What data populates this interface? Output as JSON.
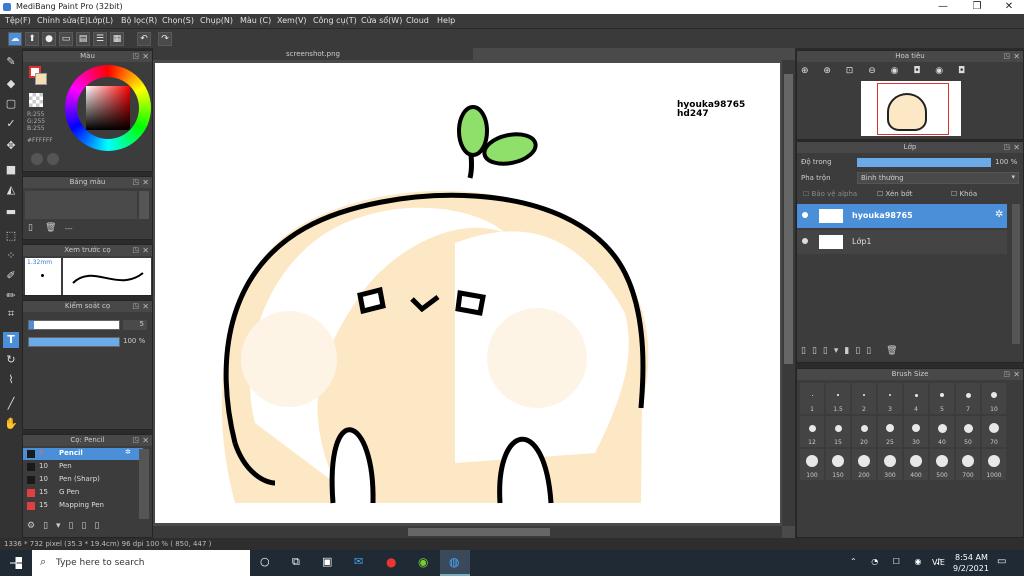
{
  "window": {
    "title": "MediBang Paint Pro (32bit)",
    "minimize": "—",
    "maximize": "❐",
    "close": "✕"
  },
  "menu": [
    "Tệp(F)",
    "Chỉnh sửa(E)",
    "Lớp(L)",
    "Bộ lọc(R)",
    "Chọn(S)",
    "Chụp(N)",
    "Màu (C)",
    "Xem(V)",
    "Công cụ(T)",
    "Cửa sổ(W)",
    "Cloud",
    "Help"
  ],
  "panels": {
    "color": {
      "title": "Màu",
      "rgb_r": "R:255",
      "rgb_g": "G:255",
      "rgb_b": "B:255",
      "hex": "#FFFFFF"
    },
    "palette": {
      "title": "Bảng màu",
      "value": "---"
    },
    "brush_preview": {
      "title": "Xem trước cọ",
      "size": "1.32mm"
    },
    "brush_control": {
      "title": "Kiểm soát cọ",
      "size_value": "5",
      "opacity_value": "100 %"
    },
    "brush_list": {
      "title": "Cọ: Pencil",
      "items": [
        {
          "size": "5",
          "name": "Pencil",
          "color": "#1a1a1a"
        },
        {
          "size": "10",
          "name": "Pen",
          "color": "#1a1a1a"
        },
        {
          "size": "10",
          "name": "Pen (Sharp)",
          "color": "#1a1a1a"
        },
        {
          "size": "15",
          "name": "G Pen",
          "color": "#e04040"
        },
        {
          "size": "15",
          "name": "Mapping Pen",
          "color": "#e04040"
        }
      ]
    },
    "navigator": {
      "title": "Hoa tiêu"
    },
    "layers": {
      "title": "Lớp",
      "opacity_label": "Độ trong",
      "opacity_value": "100 %",
      "blend_label": "Pha trộn",
      "blend_value": "Bình thường",
      "protect_alpha": "Bảo vệ alpha",
      "clipping": "Xén bớt",
      "lock": "Khóa",
      "items": [
        {
          "name": "hyouka98765",
          "selected": true
        },
        {
          "name": "Lớp1",
          "selected": false
        }
      ]
    },
    "brush_size": {
      "title": "Brush Size",
      "sizes": [
        "1",
        "1.5",
        "2",
        "3",
        "4",
        "5",
        "7",
        "10",
        "12",
        "15",
        "20",
        "25",
        "30",
        "40",
        "50",
        "70",
        "100",
        "150",
        "200",
        "300",
        "400",
        "500",
        "700",
        "1000"
      ]
    }
  },
  "document": {
    "tab": "screenshot.png",
    "watermark_line1": "hyouka98765",
    "watermark_line2": "hd247"
  },
  "status": {
    "info": "1336 * 732 pixel   (35.3 * 19.4cm)   96 dpi   100 %   ( 850, 447 )"
  },
  "taskbar": {
    "search_placeholder": "Type here to search",
    "time": "8:54 AM",
    "date": "9/2/2021",
    "lang": "VIE"
  },
  "colors": {
    "accent": "#4a8fd8",
    "panel": "#3c3c3c",
    "selected_layer": "#4a8fd8"
  }
}
